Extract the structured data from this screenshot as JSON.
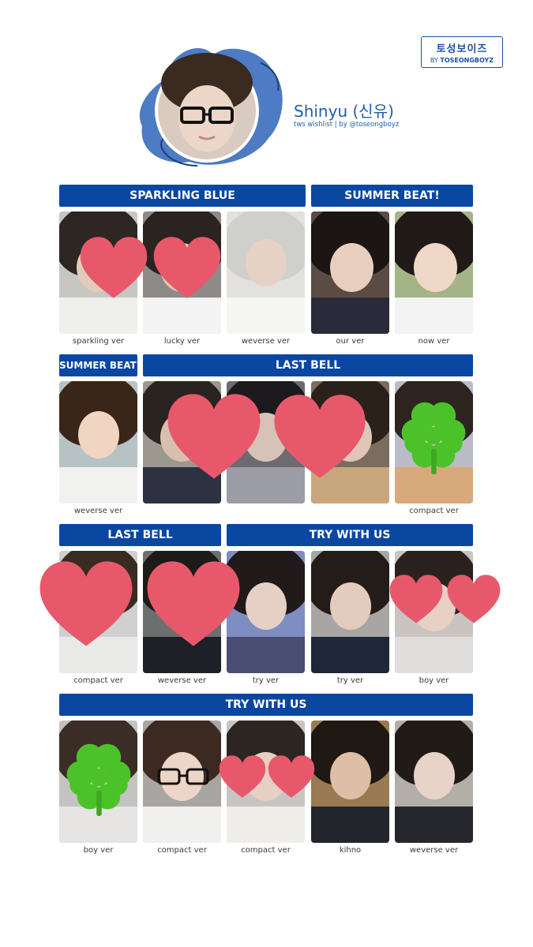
{
  "logo": {
    "korean": "토성보이즈",
    "by": "BY",
    "brand": "TOSEONGBOYZ"
  },
  "profile": {
    "name": "Shinyu (신유)",
    "subtitle": "tws wishlist | by @toseongboyz"
  },
  "banners": {
    "sparkling_blue": "SPARKLING BLUE",
    "summer_beat_1": "SUMMER BEAT!",
    "summer_beat_2": "SUMMER BEAT!",
    "last_bell_1": "LAST BELL",
    "last_bell_2": "LAST BELL",
    "try_with_us_1": "TRY WITH US",
    "try_with_us_2": "TRY WITH US"
  },
  "captions": {
    "r1": [
      "sparkling ver",
      "lucky ver",
      "weverse ver",
      "our ver",
      "now ver"
    ],
    "r2": [
      "weverse ver",
      "",
      "",
      "",
      "compact ver"
    ],
    "r3": [
      "compact ver",
      "weverse ver",
      "try ver",
      "try ver",
      "boy ver"
    ],
    "r4": [
      "boy ver",
      "compact ver",
      "compact ver",
      "kihno",
      "weverse ver"
    ]
  },
  "colors": {
    "banner": "#0a47a1",
    "heart": "#e8586b",
    "clover": "#4cc22a",
    "accent": "#1f5fae"
  }
}
